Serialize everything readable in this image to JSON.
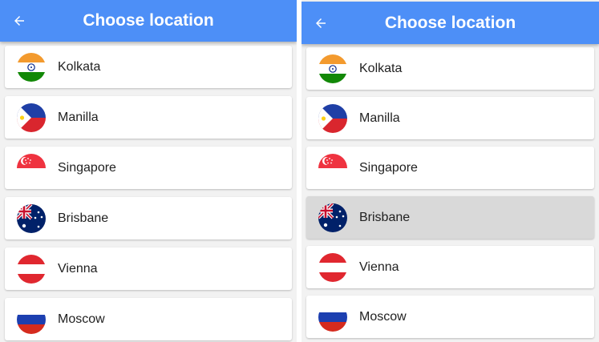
{
  "left_screen": {
    "app_bar": {
      "title": "Choose location",
      "back_icon": "arrow-left-icon"
    },
    "locations": [
      {
        "name": "Kolkata",
        "flag": "india-flag-icon"
      },
      {
        "name": "Manilla",
        "flag": "philippines-flag-icon"
      },
      {
        "name": "Singapore",
        "flag": "singapore-flag-icon"
      },
      {
        "name": "Brisbane",
        "flag": "australia-flag-icon"
      },
      {
        "name": "Vienna",
        "flag": "austria-flag-icon"
      },
      {
        "name": "Moscow",
        "flag": "russia-flag-icon"
      }
    ]
  },
  "right_screen": {
    "app_bar": {
      "title": "Choose location",
      "back_icon": "arrow-left-icon"
    },
    "locations": [
      {
        "name": "Kolkata",
        "flag": "india-flag-icon"
      },
      {
        "name": "Manilla",
        "flag": "philippines-flag-icon"
      },
      {
        "name": "Singapore",
        "flag": "singapore-flag-icon"
      },
      {
        "name": "Brisbane",
        "flag": "australia-flag-icon",
        "selected": true
      },
      {
        "name": "Vienna",
        "flag": "austria-flag-icon"
      },
      {
        "name": "Moscow",
        "flag": "russia-flag-icon"
      }
    ]
  },
  "colors": {
    "app_bar": "#4d8ff7",
    "selected_row": "#d9d9d9",
    "background": "#f2f2f2"
  }
}
